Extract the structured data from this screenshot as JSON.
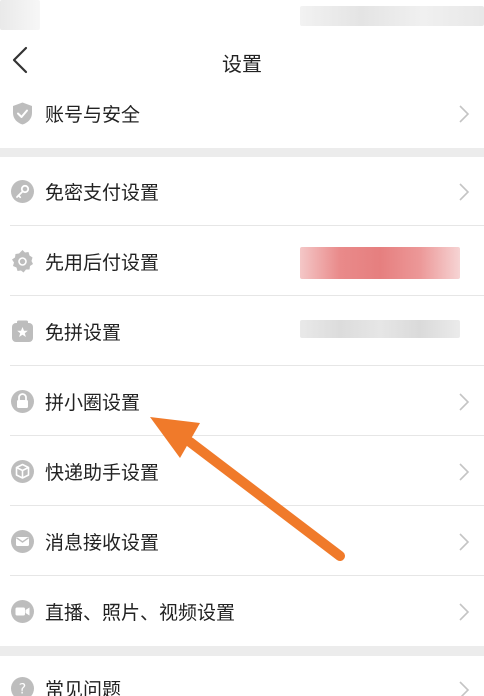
{
  "header": {
    "title": "设置"
  },
  "section1": [
    {
      "label": "账号与安全",
      "icon": "shield-check-icon"
    }
  ],
  "section2": [
    {
      "label": "免密支付设置",
      "icon": "key-icon"
    },
    {
      "label": "先用后付设置",
      "icon": "gear-badge-icon"
    },
    {
      "label": "免拼设置",
      "icon": "star-box-icon"
    },
    {
      "label": "拼小圈设置",
      "icon": "lock-icon"
    },
    {
      "label": "快递助手设置",
      "icon": "package-icon"
    },
    {
      "label": "消息接收设置",
      "icon": "mail-icon"
    },
    {
      "label": "直播、照片、视频设置",
      "icon": "video-camera-icon"
    }
  ],
  "section3": [
    {
      "label": "常见问题",
      "icon": "help-icon"
    }
  ],
  "colors": {
    "icon_gray": "#bdbdbd",
    "arrow_orange": "#f07a2a",
    "blur_pink": "#e98a8a",
    "gap_gray": "#ececec"
  }
}
